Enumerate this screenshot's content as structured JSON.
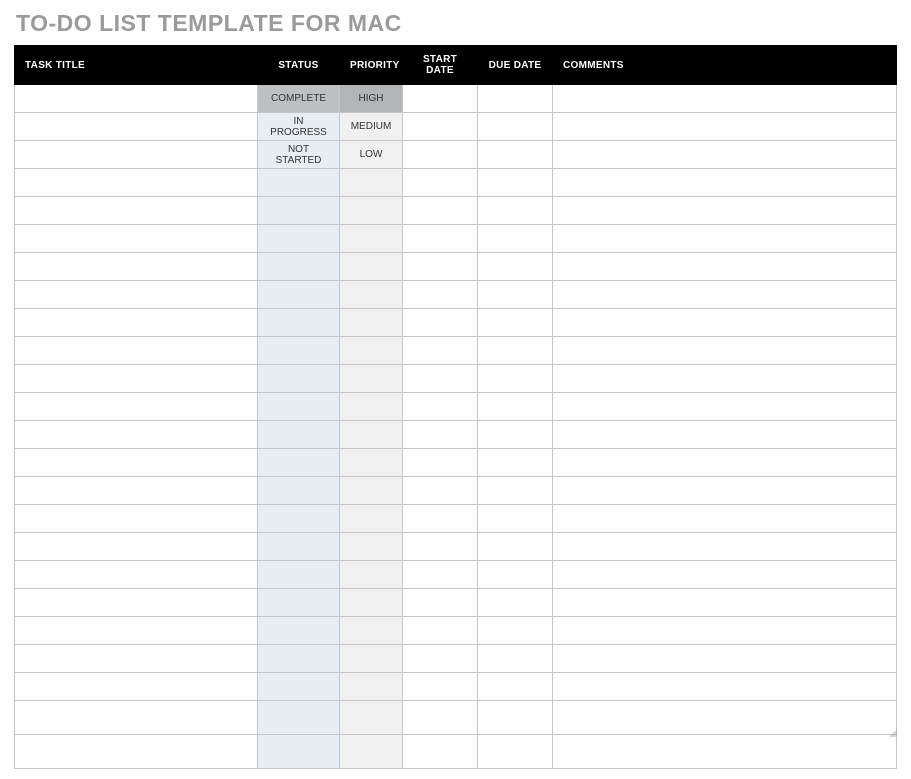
{
  "title": "TO-DO LIST TEMPLATE FOR MAC",
  "columns": {
    "task_title": "TASK TITLE",
    "status": "STATUS",
    "priority": "PRIORITY",
    "start_date": "START DATE",
    "due_date": "DUE DATE",
    "comments": "COMMENTS"
  },
  "status_options": [
    "COMPLETE",
    "IN PROGRESS",
    "NOT STARTED"
  ],
  "priority_options": [
    "HIGH",
    "MEDIUM",
    "LOW"
  ],
  "empty_row_count": 21,
  "colors": {
    "header_bg": "#000000",
    "header_text": "#ffffff",
    "title_text": "#9a9a9a",
    "status_col_bg": "#e8edf3",
    "priority_col_bg": "#f0f0f0",
    "status_filled_bg": "#bdbfc1",
    "priority_filled_bg": "#b3b4b6",
    "border": "#c6c6c6"
  }
}
